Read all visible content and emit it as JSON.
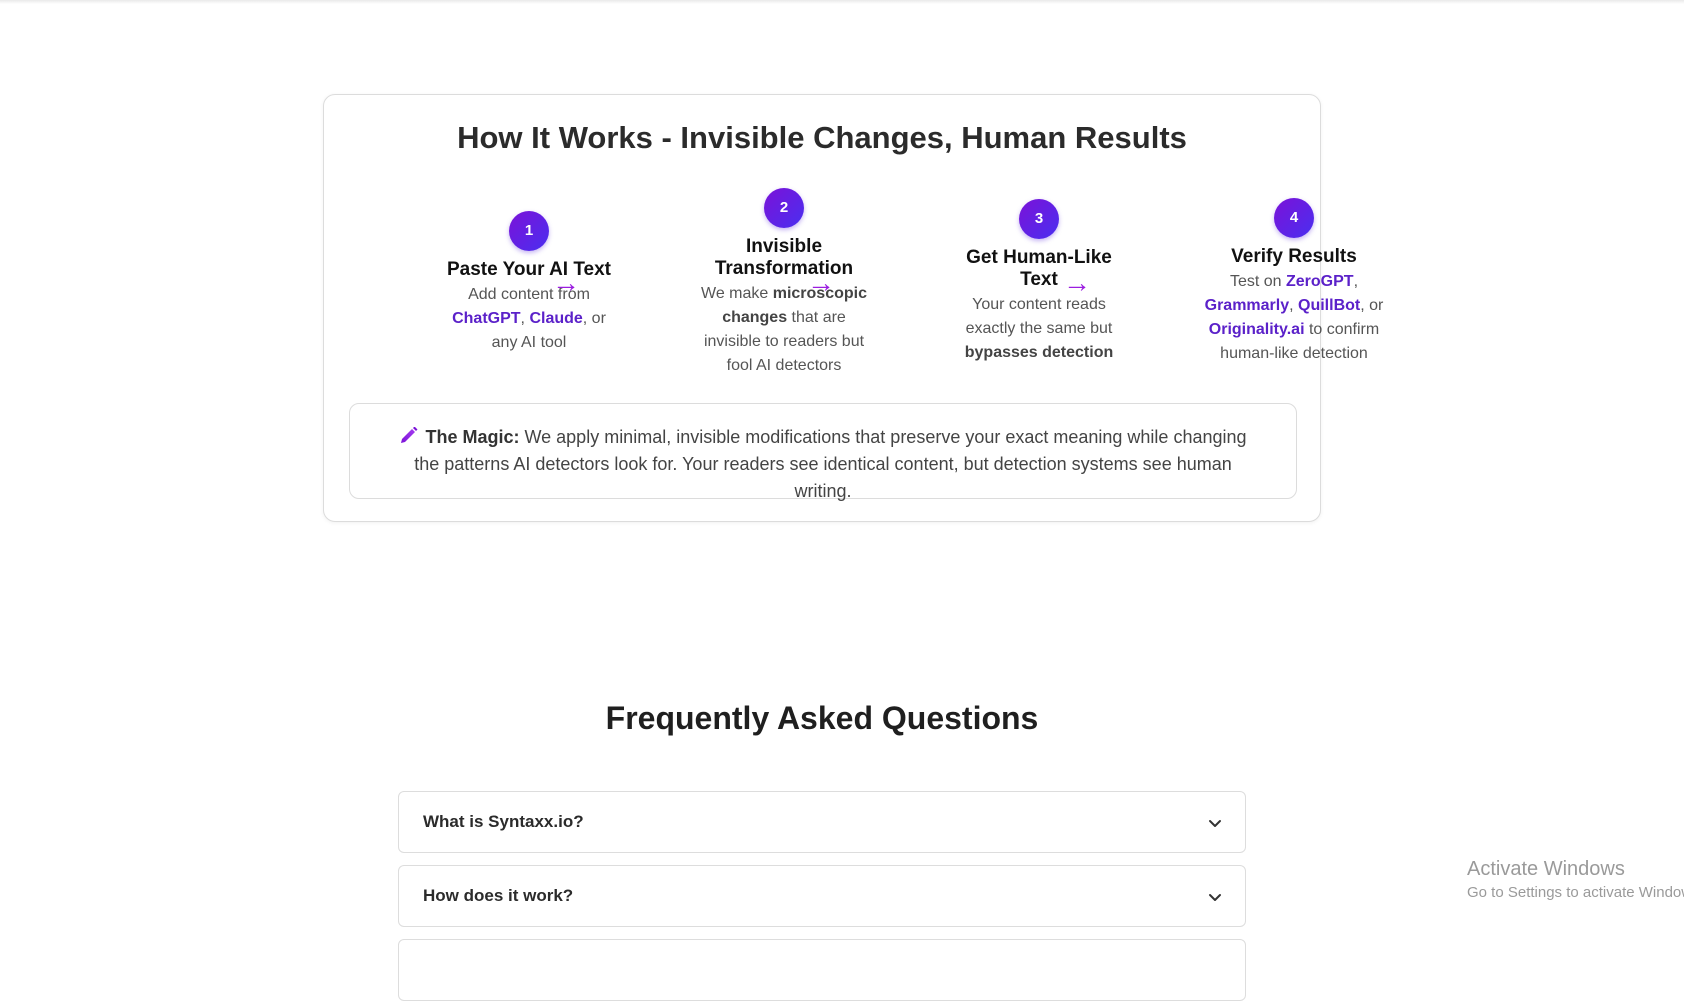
{
  "how_it_works": {
    "title": "How It Works - Invisible Changes, Human Results",
    "steps": [
      {
        "number": "1",
        "title": "Paste Your AI Text",
        "desc": [
          {
            "text": "Add content from "
          },
          {
            "text": "ChatGPT",
            "hl": true
          },
          {
            "text": ", "
          },
          {
            "text": "Claude",
            "hl": true
          },
          {
            "text": ", or any AI tool"
          }
        ]
      },
      {
        "number": "2",
        "title": "Invisible Transformation",
        "desc": [
          {
            "text": "We make "
          },
          {
            "text": "microscopic changes",
            "bold": true
          },
          {
            "text": " that are invisible to readers but fool AI detectors"
          }
        ]
      },
      {
        "number": "3",
        "title": "Get Human-Like Text",
        "desc": [
          {
            "text": "Your content reads exactly the same but "
          },
          {
            "text": "bypasses detection",
            "bold": true
          }
        ]
      },
      {
        "number": "4",
        "title": "Verify Results",
        "desc": [
          {
            "text": "Test on "
          },
          {
            "text": "ZeroGPT",
            "hl": true
          },
          {
            "text": ", "
          },
          {
            "text": "Grammarly",
            "hl": true
          },
          {
            "text": ", "
          },
          {
            "text": "QuillBot",
            "hl": true
          },
          {
            "text": ", or "
          },
          {
            "text": "Originality.ai",
            "hl": true
          },
          {
            "text": " to confirm human-like detection"
          }
        ]
      }
    ],
    "arrow": "→",
    "magic": {
      "icon": "pencil-icon",
      "label": "The Magic:",
      "text": " We apply minimal, invisible modifications that preserve your exact meaning while changing the patterns AI detectors look for. Your readers see identical content, but detection systems see human writing."
    }
  },
  "faq": {
    "title": "Frequently Asked Questions",
    "items": [
      {
        "question": "What is Syntaxx.io?"
      },
      {
        "question": "How does it work?"
      },
      {
        "question": ""
      }
    ]
  },
  "os_watermark": {
    "line1": "Activate Windows",
    "line2": "Go to Settings to activate Windows."
  },
  "colors": {
    "accent": "#5b21c9",
    "badge_gradient_start": "#7b12d8",
    "badge_gradient_end": "#4a2ff0",
    "arrow": "#9b1de0"
  }
}
